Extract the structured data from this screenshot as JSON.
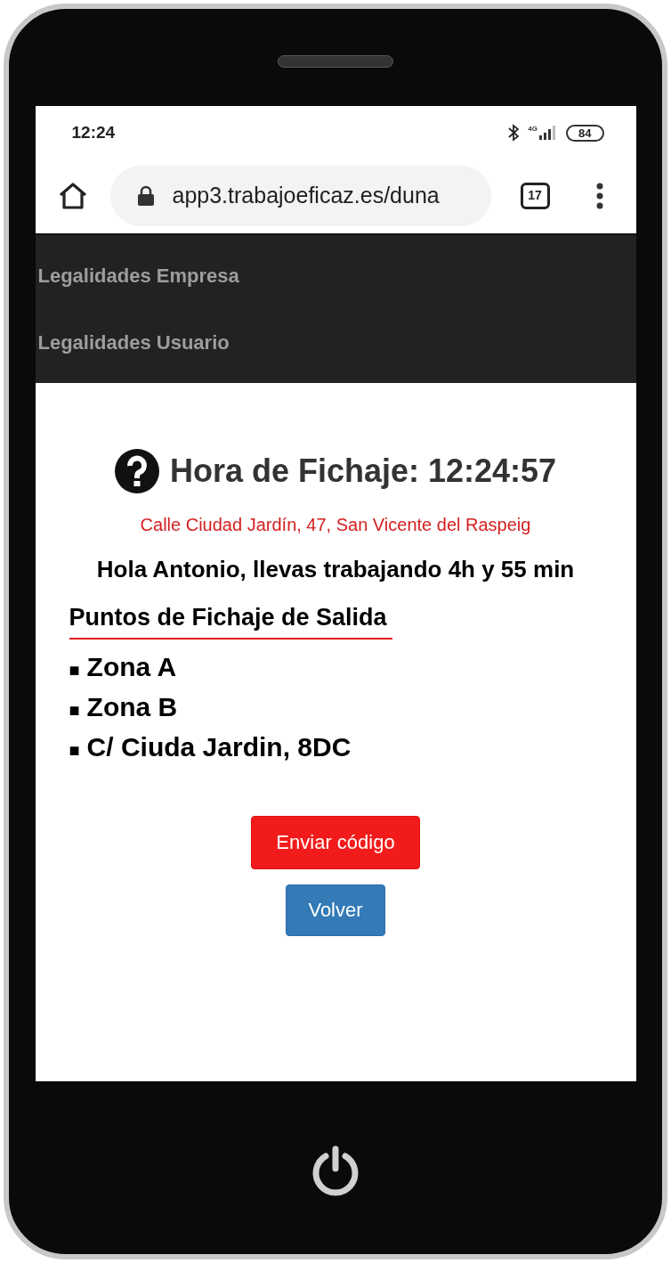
{
  "status_bar": {
    "time": "12:24",
    "network": "4G",
    "battery": "84"
  },
  "browser": {
    "url": "app3.trabajoeficaz.es/duna",
    "tab_count": "17"
  },
  "nav": {
    "items": [
      {
        "label": "Legalidades Empresa"
      },
      {
        "label": "Legalidades Usuario"
      }
    ]
  },
  "main": {
    "title": "Hora de Fichaje: 12:24:57",
    "address": "Calle Ciudad Jardín, 47, San Vicente del Raspeig",
    "greeting": "Hola Antonio, llevas trabajando 4h y 55 min",
    "section_title": "Puntos de Fichaje de Salida",
    "points": [
      {
        "bullet": "■",
        "label": "Zona A"
      },
      {
        "bullet": "■",
        "label": "Zona B"
      },
      {
        "bullet": "■",
        "label": "C/ Ciuda Jardin, 8DC"
      }
    ]
  },
  "buttons": [
    {
      "label": "Enviar código",
      "kind": "danger"
    },
    {
      "label": "Volver",
      "kind": "primary"
    }
  ]
}
